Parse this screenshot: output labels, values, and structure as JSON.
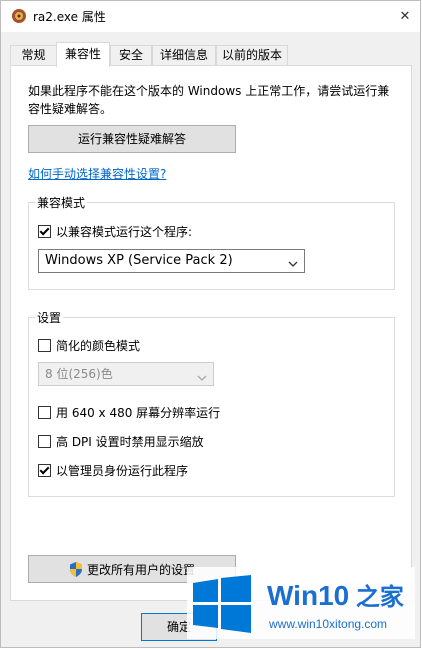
{
  "window": {
    "title": "ra2.exe 属性",
    "close_label": "✕"
  },
  "tabs": [
    {
      "label": "常规"
    },
    {
      "label": "兼容性"
    },
    {
      "label": "安全"
    },
    {
      "label": "详细信息"
    },
    {
      "label": "以前的版本"
    }
  ],
  "compat": {
    "intro": "如果此程序不能在这个版本的 Windows 上正常工作，请尝试运行兼容性疑难解答。",
    "troubleshoot_button": "运行兼容性疑难解答",
    "manual_link": "如何手动选择兼容性设置?",
    "mode_group": {
      "title": "兼容模式",
      "checkbox_label": "以兼容模式运行这个程序:",
      "checked": true,
      "select_value": "Windows XP (Service Pack 2)"
    },
    "settings_group": {
      "title": "设置",
      "reduced_color": {
        "label": "简化的颜色模式",
        "checked": false
      },
      "color_select_value": "8 位(256)色",
      "res_640": {
        "label": "用 640 x 480 屏幕分辨率运行",
        "checked": false
      },
      "high_dpi": {
        "label": "高 DPI 设置时禁用显示缩放",
        "checked": false
      },
      "run_admin": {
        "label": "以管理员身份运行此程序",
        "checked": true
      }
    },
    "all_users_button": "更改所有用户的设置",
    "ok_button": "确定"
  },
  "watermark": {
    "brand_prefix": "Win10",
    "brand_suffix": " 之家",
    "url": "www.win10xitong.com"
  },
  "colors": {
    "link": "#0066cc",
    "windows_logo": "#0078d7",
    "watermark_text": "#1a6fd1"
  }
}
